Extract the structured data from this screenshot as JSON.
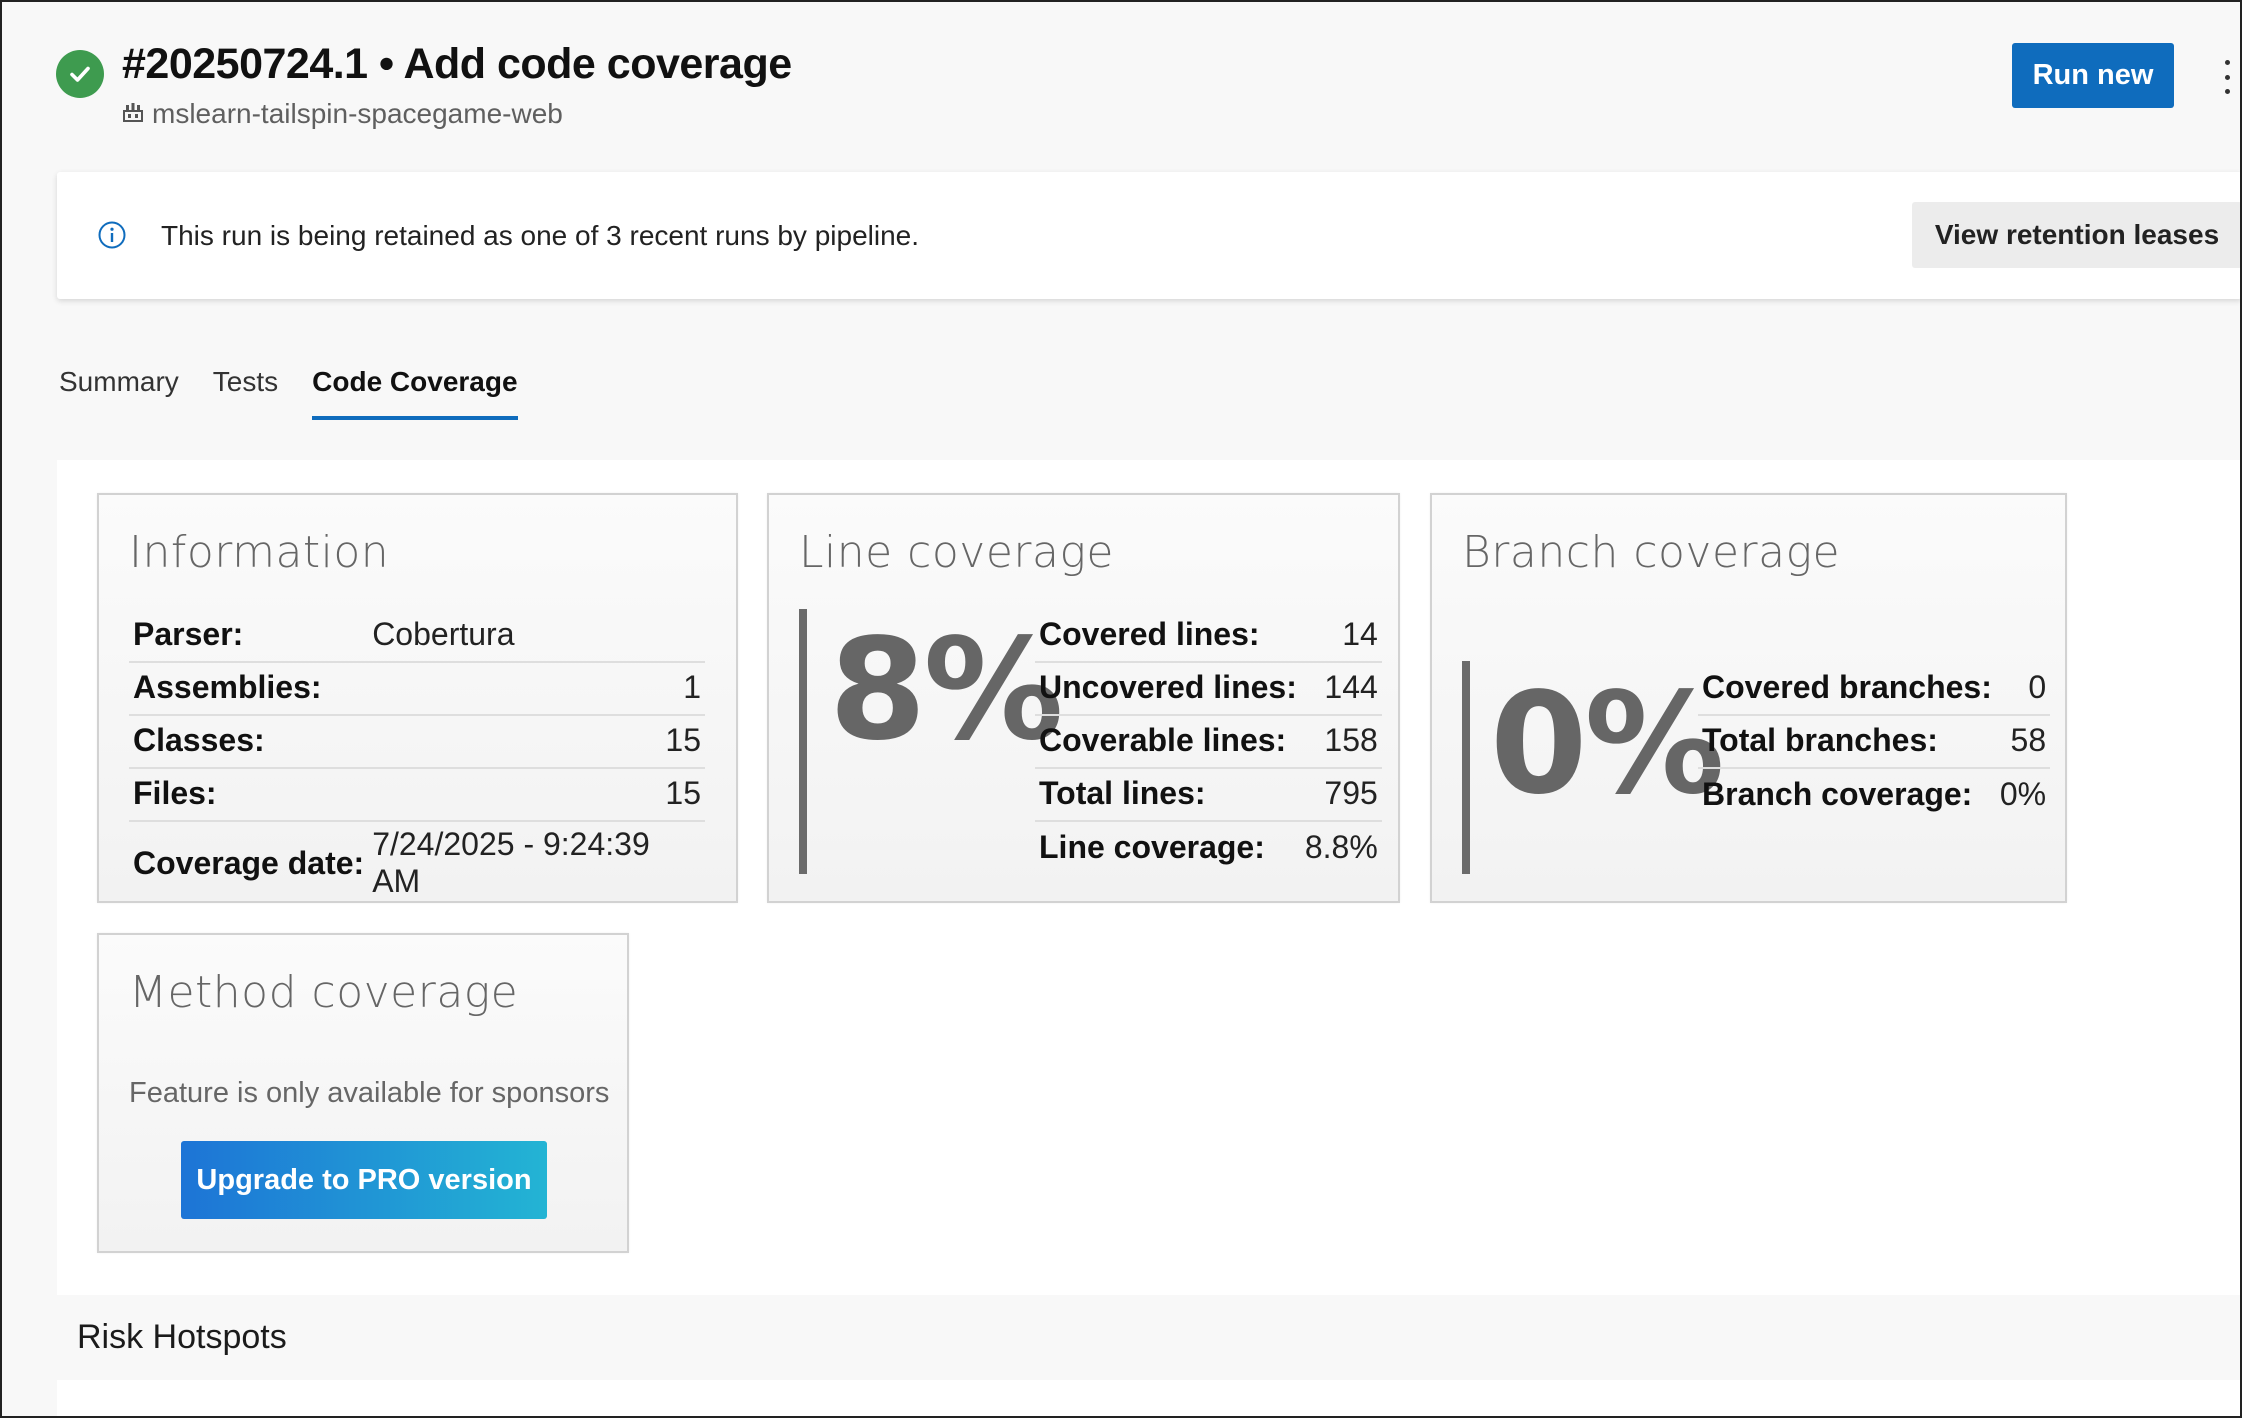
{
  "header": {
    "status": "succeeded",
    "run_title": "#20250724.1 • Add code coverage",
    "repo_name": "mslearn-tailspin-spacegame-web",
    "run_new_label": "Run new",
    "more_icon": "more-vertical-icon"
  },
  "banner": {
    "icon": "info-icon",
    "text": "This run is being retained as one of 3 recent runs by pipeline.",
    "button_label": "View retention leases"
  },
  "tabs": [
    {
      "label": "Summary",
      "selected": false
    },
    {
      "label": "Tests",
      "selected": false
    },
    {
      "label": "Code Coverage",
      "selected": true
    }
  ],
  "information": {
    "title": "Information",
    "rows": [
      {
        "key": "Parser:",
        "value": "Cobertura"
      },
      {
        "key": "Assemblies:",
        "value": "1"
      },
      {
        "key": "Classes:",
        "value": "15"
      },
      {
        "key": "Files:",
        "value": "15"
      },
      {
        "key": "Coverage date:",
        "value": "7/24/2025 - 9:24:39 AM"
      }
    ]
  },
  "line_coverage": {
    "title": "Line coverage",
    "percent": "8%",
    "rows": [
      {
        "key": "Covered lines:",
        "value": "14"
      },
      {
        "key": "Uncovered lines:",
        "value": "144"
      },
      {
        "key": "Coverable lines:",
        "value": "158"
      },
      {
        "key": "Total lines:",
        "value": "795"
      },
      {
        "key": "Line coverage:",
        "value": "8.8%"
      }
    ]
  },
  "branch_coverage": {
    "title": "Branch coverage",
    "percent": "0%",
    "rows": [
      {
        "key": "Covered branches:",
        "value": "0"
      },
      {
        "key": "Total branches:",
        "value": "58"
      },
      {
        "key": "Branch coverage:",
        "value": "0%"
      }
    ]
  },
  "method_coverage": {
    "title": "Method coverage",
    "message": "Feature is only available for sponsors",
    "button_label": "Upgrade to PRO version"
  },
  "risk_hotspots": {
    "heading": "Risk Hotspots"
  },
  "colors": {
    "accent": "#0f6cbd",
    "success": "#3e9b4f",
    "upgrade_gradient_start": "#1d74d6",
    "upgrade_gradient_end": "#23b4d4"
  }
}
